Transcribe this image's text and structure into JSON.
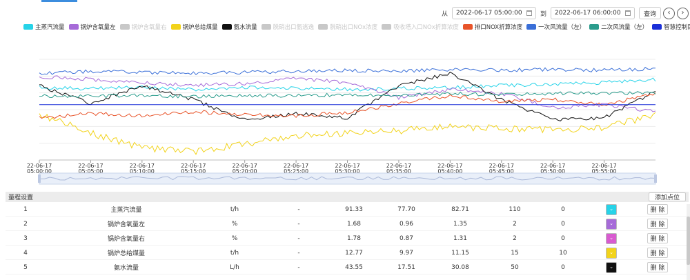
{
  "toolbar": {
    "from_label": "从",
    "to_label": "到",
    "start_time": "2022-06-17 05:00:00",
    "end_time": "2022-06-17 06:00:00",
    "query_label": "查询",
    "prev_icon": "chevron-left-icon",
    "next_icon": "chevron-right-icon"
  },
  "legend": [
    {
      "label": "主蒸汽流量",
      "color": "#27d3e8",
      "active": true
    },
    {
      "label": "锅炉含氧量左",
      "color": "#a66bd8",
      "active": true
    },
    {
      "label": "锅炉含氧量右",
      "color": "#c8c8c8",
      "active": false
    },
    {
      "label": "锅炉总给煤量",
      "color": "#f2d31b",
      "active": true
    },
    {
      "label": "氨水流量",
      "color": "#111111",
      "active": true
    },
    {
      "label": "脱硝出口氨逃逸",
      "color": "#c8c8c8",
      "active": false
    },
    {
      "label": "脱硝出口NOx浓度",
      "color": "#c8c8c8",
      "active": false
    },
    {
      "label": "吸收塔入口NOx折算浓度",
      "color": "#c8c8c8",
      "active": false
    },
    {
      "label": "排口NOX折算浓度",
      "color": "#e8542a",
      "active": true
    },
    {
      "label": "一次风流量（左）",
      "color": "#3a6fd8",
      "active": true
    },
    {
      "label": "二次风流量（左）",
      "color": "#2a9c8c",
      "active": true
    },
    {
      "label": "智慧控制目标值",
      "color": "#1a2fd8",
      "active": true
    }
  ],
  "chart_data": {
    "type": "line",
    "x_ticks": [
      "22-06-17 05:00:00",
      "22-06-17 05:05:00",
      "22-06-17 05:10:00",
      "22-06-17 05:15:00",
      "22-06-17 05:20:00",
      "22-06-17 05:25:00",
      "22-06-17 05:30:00",
      "22-06-17 05:35:00",
      "22-06-17 05:40:00",
      "22-06-17 05:45:00",
      "22-06-17 05:50:00",
      "22-06-17 05:55:00"
    ],
    "x": [
      0,
      5,
      10,
      15,
      20,
      25,
      30,
      35,
      40,
      45,
      50,
      55,
      60
    ],
    "grid": true,
    "series": [
      {
        "name": "主蒸汽流量",
        "color": "#27d3e8",
        "values": [
          0.72,
          0.71,
          0.72,
          0.7,
          0.72,
          0.71,
          0.7,
          0.71,
          0.72,
          0.74,
          0.75,
          0.77,
          0.8
        ]
      },
      {
        "name": "锅炉含氧量左",
        "color": "#a66bd8",
        "values": [
          0.83,
          0.8,
          0.77,
          0.74,
          0.76,
          0.81,
          0.77,
          0.62,
          0.7,
          0.66,
          0.52,
          0.55,
          0.48
        ]
      },
      {
        "name": "锅炉总给煤量",
        "color": "#f2d31b",
        "values": [
          0.45,
          0.27,
          0.12,
          0.08,
          0.16,
          0.24,
          0.26,
          0.29,
          0.33,
          0.31,
          0.3,
          0.32,
          0.45
        ]
      },
      {
        "name": "氨水流量",
        "color": "#111111",
        "values": [
          0.74,
          0.56,
          0.74,
          0.6,
          0.4,
          0.46,
          0.42,
          0.74,
          0.86,
          0.6,
          0.4,
          0.42,
          0.68
        ]
      },
      {
        "name": "排口NOX折算浓度",
        "color": "#e8542a",
        "values": [
          0.42,
          0.46,
          0.44,
          0.48,
          0.45,
          0.44,
          0.47,
          0.56,
          0.64,
          0.58,
          0.6,
          0.55,
          0.66
        ]
      },
      {
        "name": "一次风流量（左）",
        "color": "#3a6fd8",
        "values": [
          0.86,
          0.88,
          0.87,
          0.86,
          0.87,
          0.88,
          0.89,
          0.88,
          0.9,
          0.89,
          0.9,
          0.89,
          0.91
        ]
      },
      {
        "name": "二次风流量（左）",
        "color": "#2a9c8c",
        "values": [
          0.64,
          0.63,
          0.64,
          0.63,
          0.64,
          0.64,
          0.65,
          0.64,
          0.66,
          0.65,
          0.66,
          0.66,
          0.67
        ]
      },
      {
        "name": "智慧控制目标值",
        "color": "#1a2fd8",
        "values": [
          0.55,
          0.55,
          0.55,
          0.55,
          0.55,
          0.55,
          0.55,
          0.55,
          0.55,
          0.55,
          0.55,
          0.55,
          0.55
        ]
      }
    ]
  },
  "range_table": {
    "title": "量程设置",
    "add_label": "添加点位",
    "delete_label": "删 除",
    "rows": [
      {
        "idx": "1",
        "name": "主蒸汽流量",
        "unit": "t/h",
        "dash": "-",
        "v1": "91.33",
        "v2": "77.70",
        "v3": "82.71",
        "max": "110",
        "min": "0",
        "color": "#27d3e8"
      },
      {
        "idx": "2",
        "name": "锅炉含氧量左",
        "unit": "%",
        "dash": "-",
        "v1": "1.68",
        "v2": "0.96",
        "v3": "1.35",
        "max": "2",
        "min": "0",
        "color": "#a66bd8"
      },
      {
        "idx": "3",
        "name": "锅炉含氧量右",
        "unit": "%",
        "dash": "-",
        "v1": "1.78",
        "v2": "0.87",
        "v3": "1.31",
        "max": "2",
        "min": "0",
        "color": "#d85bd0"
      },
      {
        "idx": "4",
        "name": "锅炉总给煤量",
        "unit": "t/h",
        "dash": "-",
        "v1": "12.77",
        "v2": "9.97",
        "v3": "11.15",
        "max": "15",
        "min": "10",
        "color": "#f2d31b"
      },
      {
        "idx": "5",
        "name": "氨水流量",
        "unit": "L/h",
        "dash": "-",
        "v1": "43.55",
        "v2": "17.51",
        "v3": "30.08",
        "max": "50",
        "min": "0",
        "color": "#111111"
      }
    ]
  }
}
